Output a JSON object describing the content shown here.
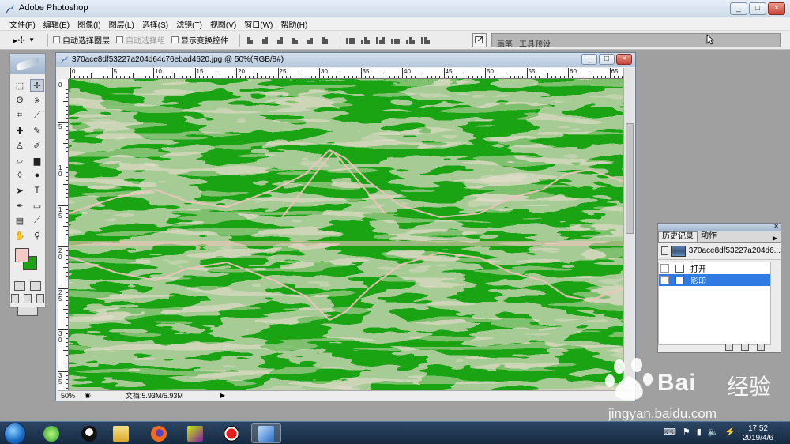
{
  "app": {
    "title": "Adobe Photoshop",
    "window_controls": [
      "_",
      "□",
      "×"
    ]
  },
  "menubar": {
    "items": [
      "文件(F)",
      "编辑(E)",
      "图像(I)",
      "图层(L)",
      "选择(S)",
      "滤镜(T)",
      "视图(V)",
      "窗口(W)",
      "帮助(H)"
    ]
  },
  "options_bar": {
    "auto_select_layer": "自动选择图层",
    "auto_select_group": "自动选择组",
    "show_transform": "显示变换控件"
  },
  "palette_well": {
    "tabs": [
      "画笔",
      "工具预设"
    ]
  },
  "toolbox": {
    "foreground_color": "#f5c9c6",
    "background_color": "#1aa312"
  },
  "document": {
    "title": "370ace8df53227a204d64c76ebad4620.jpg @ 50%(RGB/8#)",
    "ruler_top": [
      "0",
      "5",
      "10",
      "15",
      "20",
      "25",
      "30",
      "35",
      "40",
      "45",
      "50",
      "55",
      "60",
      "65"
    ],
    "ruler_left": [
      "0",
      "5",
      "1\n0",
      "1\n5",
      "2\n0",
      "2\n5",
      "3\n0",
      "3\n5"
    ],
    "zoom": "50%",
    "doc_size": "文档:5.93M/5.93M",
    "effect_colors": {
      "green": "#1aa312",
      "pink": "#f2c4c0"
    }
  },
  "history_panel": {
    "tabs": [
      "历史记录",
      "动作"
    ],
    "snapshot_name": "370ace8df53227a204d6...",
    "steps": [
      {
        "label": "打开",
        "selected": false
      },
      {
        "label": "影印",
        "selected": true
      }
    ]
  },
  "taskbar": {
    "time": "17:52",
    "date": "2019/4/6",
    "apps": [
      "360-browser",
      "qq",
      "file-explorer",
      "firefox",
      "video-player",
      "screen-recorder",
      "photoshop"
    ]
  },
  "watermark": {
    "brand_en": "Bai",
    "brand_suffix": "经验",
    "url": "jingyan.baidu.com"
  }
}
